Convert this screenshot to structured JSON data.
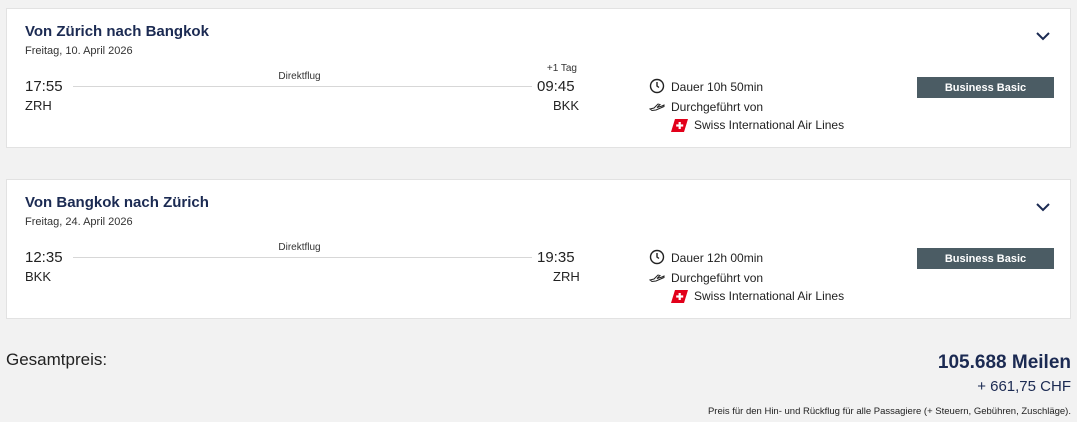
{
  "flights": [
    {
      "title": "Von Zürich nach Bangkok",
      "date": "Freitag, 10. April 2026",
      "dep_time": "17:55",
      "dep_code": "ZRH",
      "arr_time": "09:45",
      "arr_code": "BKK",
      "plus_day": "+1 Tag",
      "direct": "Direktflug",
      "duration": "Dauer 10h 50min",
      "operated": "Durchgeführt von",
      "airline": "Swiss International Air Lines",
      "fare": "Business Basic"
    },
    {
      "title": "Von Bangkok nach Zürich",
      "date": "Freitag, 24. April 2026",
      "dep_time": "12:35",
      "dep_code": "BKK",
      "arr_time": "19:35",
      "arr_code": "ZRH",
      "plus_day": "",
      "direct": "Direktflug",
      "duration": "Dauer 12h 00min",
      "operated": "Durchgeführt von",
      "airline": "Swiss International Air Lines",
      "fare": "Business Basic"
    }
  ],
  "total": {
    "label": "Gesamtpreis:",
    "miles": "105.688 Meilen",
    "chf": "+ 661,75 CHF",
    "note": "Preis für den Hin- und Rückflug für alle Passagiere (+ Steuern, Gebühren, Zuschläge)."
  },
  "colors": {
    "navy": "#1b2a52",
    "badge": "#4b5c64",
    "swiss_red": "#e2001a"
  },
  "icons": [
    "chevron-down-icon",
    "clock-icon",
    "plane-icon",
    "swiss-flag-icon"
  ]
}
